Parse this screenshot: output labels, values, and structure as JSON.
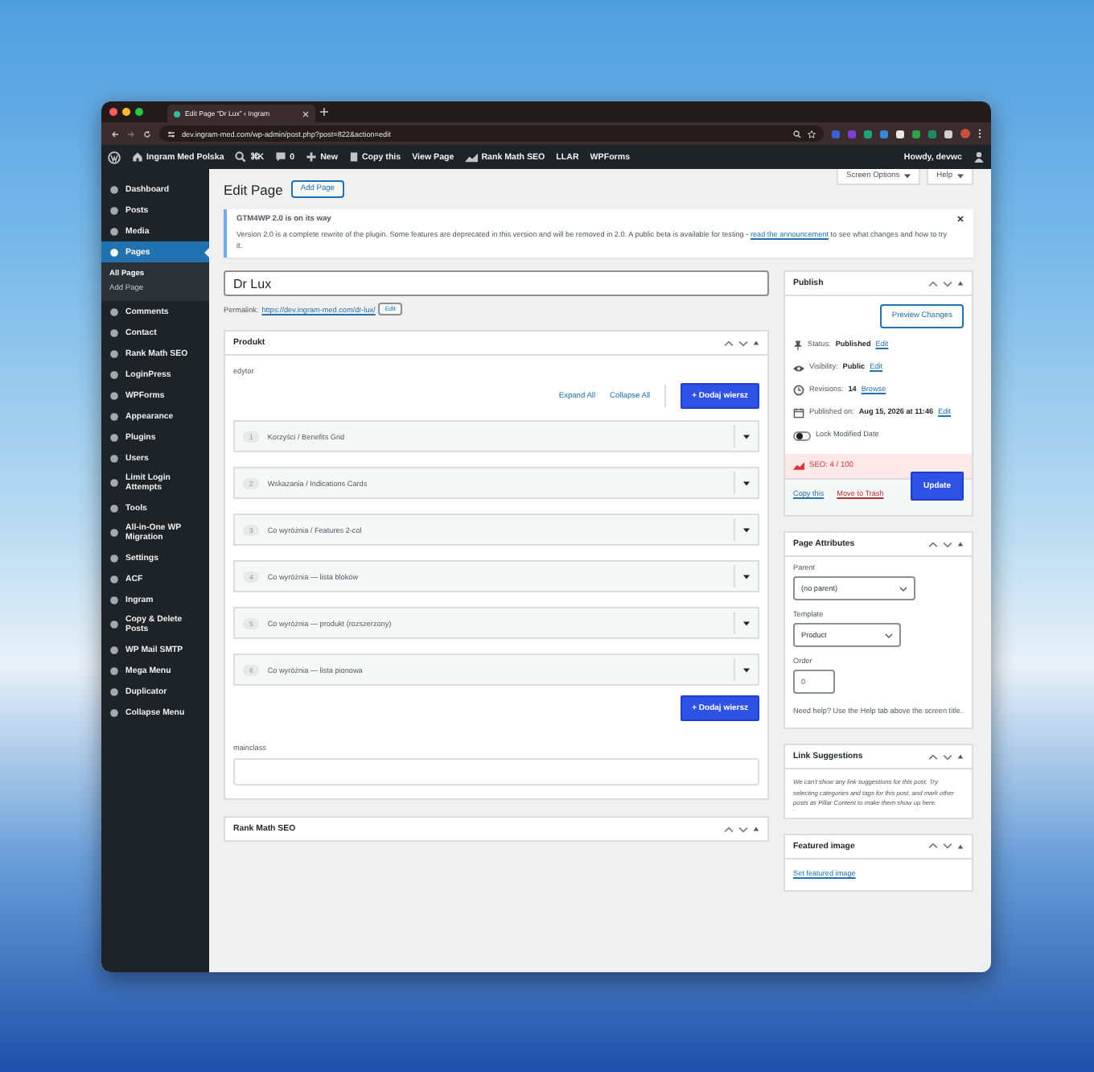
{
  "browser": {
    "tab_title": "Edit Page “Dr Lux” ‹ Ingram",
    "url": "dev.ingram-med.com/wp-admin/post.php?post=822&action=edit"
  },
  "admin_bar": {
    "items": [
      {
        "kind": "site",
        "label": "Ingram Med Polska"
      },
      {
        "kind": "search",
        "label": "⌘K"
      },
      {
        "kind": "comments",
        "label": "0"
      },
      {
        "kind": "new",
        "label": "New"
      },
      {
        "kind": "copy",
        "label": "Copy this"
      },
      {
        "kind": "plain",
        "label": "View Page"
      },
      {
        "kind": "chart",
        "label": "Rank Math SEO"
      },
      {
        "kind": "plain",
        "label": "LLAR"
      },
      {
        "kind": "plain",
        "label": "WPForms"
      }
    ],
    "greeting": "Howdy, devwc"
  },
  "sidebar": {
    "items": [
      {
        "label": "Dashboard",
        "selected": false
      },
      {
        "label": "Posts",
        "selected": false
      },
      {
        "label": "Media",
        "selected": false
      },
      {
        "label": "Pages",
        "selected": true,
        "children": [
          {
            "label": "All Pages",
            "selected": true
          },
          {
            "label": "Add Page",
            "selected": false
          }
        ]
      },
      {
        "label": "Comments",
        "selected": false
      },
      {
        "label": "Contact",
        "selected": false
      },
      {
        "label": "Rank Math SEO",
        "selected": false
      },
      {
        "label": "LoginPress",
        "selected": false
      },
      {
        "label": "WPForms",
        "selected": false
      },
      {
        "label": "Appearance",
        "selected": false
      },
      {
        "label": "Plugins",
        "selected": false
      },
      {
        "label": "Users",
        "selected": false
      },
      {
        "label": "Limit Login Attempts",
        "selected": false
      },
      {
        "label": "Tools",
        "selected": false
      },
      {
        "label": "All-in-One WP Migration",
        "selected": false
      },
      {
        "label": "Settings",
        "selected": false
      },
      {
        "label": "ACF",
        "selected": false
      },
      {
        "label": "Ingram",
        "selected": false
      },
      {
        "label": "Copy & Delete Posts",
        "selected": false
      },
      {
        "label": "WP Mail SMTP",
        "selected": false
      },
      {
        "label": "Mega Menu",
        "selected": false
      },
      {
        "label": "Duplicator",
        "selected": false
      },
      {
        "label": "Collapse Menu",
        "selected": false
      }
    ]
  },
  "page_header": {
    "title": "Edit Page",
    "add_button": "Add Page",
    "screen_options": "Screen Options",
    "help": "Help"
  },
  "notice": {
    "title": "GTM4WP 2.0 is on its way",
    "text": "Version 2.0 is a complete rewrite of the plugin. Some features are deprecated in this version and will be removed in 2.0. A public beta is available for testing - ",
    "link": "read the announcement",
    "text_after": " to see what changes and how to try it."
  },
  "title_field": {
    "value": "Dr Lux"
  },
  "permalink": {
    "label": "Permalink:",
    "url": "https://dev.ingram-med.com/dr-lux/",
    "edit": "Edit"
  },
  "produkt_box": {
    "title": "Produkt",
    "field_label": "edytor",
    "expand_all": "Expand All",
    "collapse_all": "Collapse All",
    "add_row_top": "+ Dodaj wiersz",
    "rows": [
      {
        "index": "1",
        "label": "Korzyści / Benefits Grid"
      },
      {
        "index": "2",
        "label": "Wskazania / Indications Cards"
      },
      {
        "index": "3",
        "label": "Co wyróżnia / Features 2-col"
      },
      {
        "index": "4",
        "label": "Co wyróżnia — lista bloków"
      },
      {
        "index": "5",
        "label": "Co wyróżnia — produkt (rozszerzony)"
      },
      {
        "index": "6",
        "label": "Co wyróżnia — lista pionowa"
      }
    ],
    "add_row_bottom": "+ Dodaj wiersz",
    "mainclass_label": "mainclass"
  },
  "rank_math_box": {
    "title": "Rank Math SEO"
  },
  "publish": {
    "title": "Publish",
    "preview": "Preview Changes",
    "meta": [
      {
        "kind": "pin",
        "label": "Status:",
        "value": "Published",
        "link": "Edit"
      },
      {
        "kind": "eye",
        "label": "Visibility:",
        "value": "Public",
        "link": "Edit"
      },
      {
        "kind": "clock",
        "label": "Revisions:",
        "value": "14",
        "link": "Browse"
      },
      {
        "kind": "calendar",
        "label": "Published on:",
        "value": "Aug 15, 2026 at 11:46",
        "link": "Edit"
      }
    ],
    "lock": {
      "label": "Lock Modified Date",
      "on": false
    },
    "seo": "SEO: 4 / 100",
    "copy": "Copy this",
    "trash": "Move to Trash",
    "update": "Update"
  },
  "page_attributes": {
    "title": "Page Attributes",
    "parent_label": "Parent",
    "parent_value": "(no parent)",
    "template_label": "Template",
    "template_value": "Product",
    "order_label": "Order",
    "order_value": "0",
    "help": "Need help? Use the Help tab above the screen title."
  },
  "link_suggestions": {
    "title": "Link Suggestions",
    "text": "We can't show any link suggestions for this post. Try selecting categories and tags for this post, and mark other posts as Pillar Content to make them show up here."
  },
  "featured_image": {
    "title": "Featured image",
    "link": "Set featured image"
  }
}
